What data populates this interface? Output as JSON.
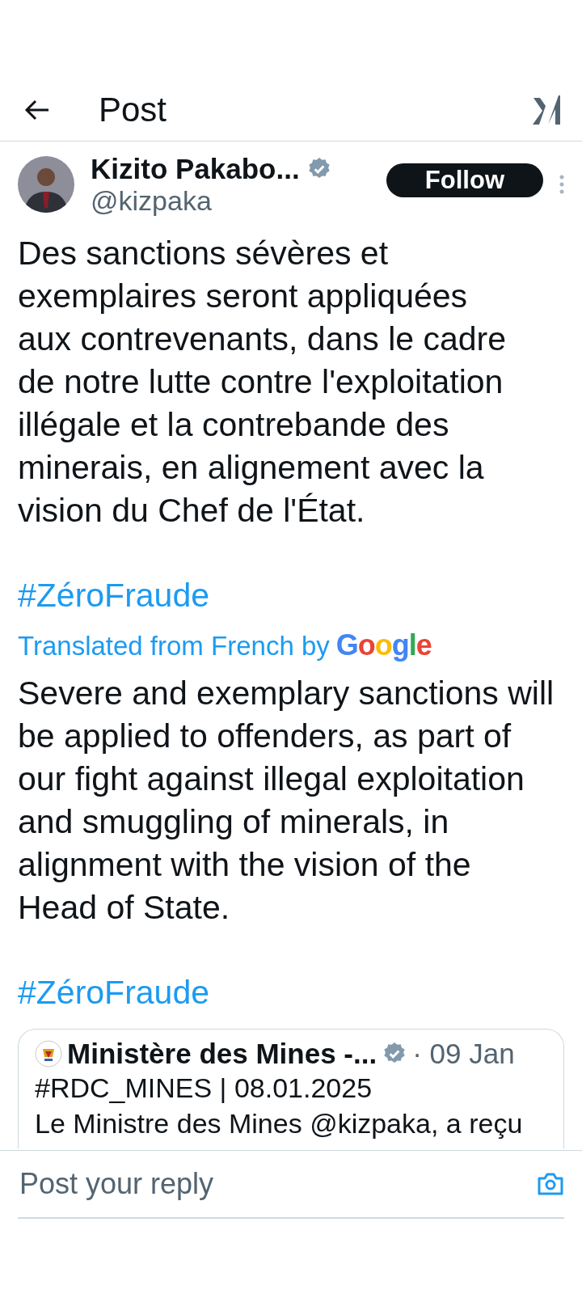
{
  "header": {
    "title": "Post"
  },
  "post": {
    "author": {
      "name": "Kizito Pakabo...",
      "verified": true,
      "handle": "@kizpaka"
    },
    "follow_label": "Follow",
    "text": "Des sanctions sévères et\nexemplaires seront appliquées\naux contrevenants, dans le cadre\nde notre lutte contre l'exploitation\nillégale et la contrebande des\nminerais, en alignement avec la\nvision du Chef de l'État.",
    "hashtag": "#ZéroFraude",
    "translation_note": "Translated from French by",
    "translation_brand": "Google",
    "translated_text": "Severe and exemplary sanctions will\nbe applied to offenders, as part of\nour fight against illegal exploitation\nand smuggling of minerals, in\nalignment with the vision of the\nHead of State.",
    "translated_hashtag": "#ZéroFraude",
    "quote": {
      "author": "Ministère des Mines -...",
      "verified": true,
      "date": "· 09 Jan",
      "line_1": "#RDC_MINES | 08.01.2025",
      "line_2": "Le Ministre des Mines @kizpaka, a reçu"
    }
  },
  "reply": {
    "placeholder": "Post your reply"
  }
}
